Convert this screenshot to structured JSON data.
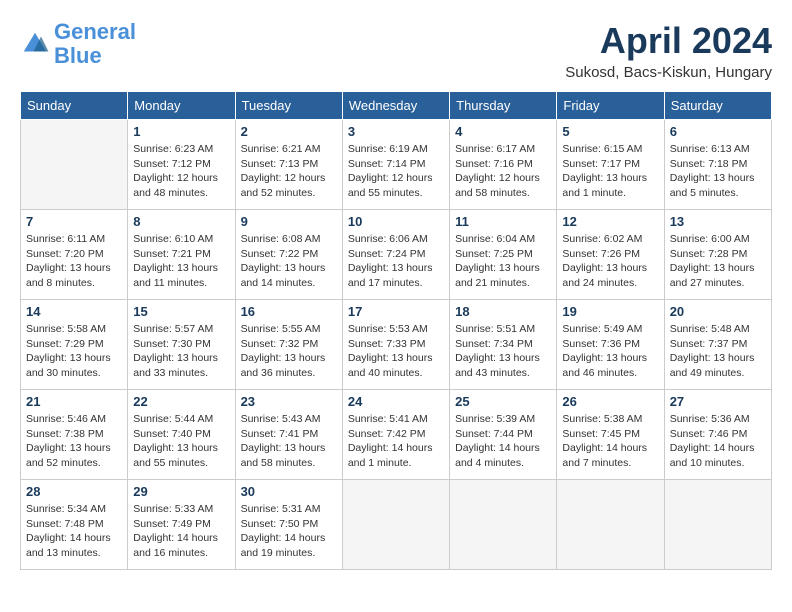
{
  "logo": {
    "text_general": "General",
    "text_blue": "Blue"
  },
  "title": "April 2024",
  "subtitle": "Sukosd, Bacs-Kiskun, Hungary",
  "days_of_week": [
    "Sunday",
    "Monday",
    "Tuesday",
    "Wednesday",
    "Thursday",
    "Friday",
    "Saturday"
  ],
  "weeks": [
    [
      {
        "day": "",
        "info": ""
      },
      {
        "day": "1",
        "info": "Sunrise: 6:23 AM\nSunset: 7:12 PM\nDaylight: 12 hours\nand 48 minutes."
      },
      {
        "day": "2",
        "info": "Sunrise: 6:21 AM\nSunset: 7:13 PM\nDaylight: 12 hours\nand 52 minutes."
      },
      {
        "day": "3",
        "info": "Sunrise: 6:19 AM\nSunset: 7:14 PM\nDaylight: 12 hours\nand 55 minutes."
      },
      {
        "day": "4",
        "info": "Sunrise: 6:17 AM\nSunset: 7:16 PM\nDaylight: 12 hours\nand 58 minutes."
      },
      {
        "day": "5",
        "info": "Sunrise: 6:15 AM\nSunset: 7:17 PM\nDaylight: 13 hours\nand 1 minute."
      },
      {
        "day": "6",
        "info": "Sunrise: 6:13 AM\nSunset: 7:18 PM\nDaylight: 13 hours\nand 5 minutes."
      }
    ],
    [
      {
        "day": "7",
        "info": "Sunrise: 6:11 AM\nSunset: 7:20 PM\nDaylight: 13 hours\nand 8 minutes."
      },
      {
        "day": "8",
        "info": "Sunrise: 6:10 AM\nSunset: 7:21 PM\nDaylight: 13 hours\nand 11 minutes."
      },
      {
        "day": "9",
        "info": "Sunrise: 6:08 AM\nSunset: 7:22 PM\nDaylight: 13 hours\nand 14 minutes."
      },
      {
        "day": "10",
        "info": "Sunrise: 6:06 AM\nSunset: 7:24 PM\nDaylight: 13 hours\nand 17 minutes."
      },
      {
        "day": "11",
        "info": "Sunrise: 6:04 AM\nSunset: 7:25 PM\nDaylight: 13 hours\nand 21 minutes."
      },
      {
        "day": "12",
        "info": "Sunrise: 6:02 AM\nSunset: 7:26 PM\nDaylight: 13 hours\nand 24 minutes."
      },
      {
        "day": "13",
        "info": "Sunrise: 6:00 AM\nSunset: 7:28 PM\nDaylight: 13 hours\nand 27 minutes."
      }
    ],
    [
      {
        "day": "14",
        "info": "Sunrise: 5:58 AM\nSunset: 7:29 PM\nDaylight: 13 hours\nand 30 minutes."
      },
      {
        "day": "15",
        "info": "Sunrise: 5:57 AM\nSunset: 7:30 PM\nDaylight: 13 hours\nand 33 minutes."
      },
      {
        "day": "16",
        "info": "Sunrise: 5:55 AM\nSunset: 7:32 PM\nDaylight: 13 hours\nand 36 minutes."
      },
      {
        "day": "17",
        "info": "Sunrise: 5:53 AM\nSunset: 7:33 PM\nDaylight: 13 hours\nand 40 minutes."
      },
      {
        "day": "18",
        "info": "Sunrise: 5:51 AM\nSunset: 7:34 PM\nDaylight: 13 hours\nand 43 minutes."
      },
      {
        "day": "19",
        "info": "Sunrise: 5:49 AM\nSunset: 7:36 PM\nDaylight: 13 hours\nand 46 minutes."
      },
      {
        "day": "20",
        "info": "Sunrise: 5:48 AM\nSunset: 7:37 PM\nDaylight: 13 hours\nand 49 minutes."
      }
    ],
    [
      {
        "day": "21",
        "info": "Sunrise: 5:46 AM\nSunset: 7:38 PM\nDaylight: 13 hours\nand 52 minutes."
      },
      {
        "day": "22",
        "info": "Sunrise: 5:44 AM\nSunset: 7:40 PM\nDaylight: 13 hours\nand 55 minutes."
      },
      {
        "day": "23",
        "info": "Sunrise: 5:43 AM\nSunset: 7:41 PM\nDaylight: 13 hours\nand 58 minutes."
      },
      {
        "day": "24",
        "info": "Sunrise: 5:41 AM\nSunset: 7:42 PM\nDaylight: 14 hours\nand 1 minute."
      },
      {
        "day": "25",
        "info": "Sunrise: 5:39 AM\nSunset: 7:44 PM\nDaylight: 14 hours\nand 4 minutes."
      },
      {
        "day": "26",
        "info": "Sunrise: 5:38 AM\nSunset: 7:45 PM\nDaylight: 14 hours\nand 7 minutes."
      },
      {
        "day": "27",
        "info": "Sunrise: 5:36 AM\nSunset: 7:46 PM\nDaylight: 14 hours\nand 10 minutes."
      }
    ],
    [
      {
        "day": "28",
        "info": "Sunrise: 5:34 AM\nSunset: 7:48 PM\nDaylight: 14 hours\nand 13 minutes."
      },
      {
        "day": "29",
        "info": "Sunrise: 5:33 AM\nSunset: 7:49 PM\nDaylight: 14 hours\nand 16 minutes."
      },
      {
        "day": "30",
        "info": "Sunrise: 5:31 AM\nSunset: 7:50 PM\nDaylight: 14 hours\nand 19 minutes."
      },
      {
        "day": "",
        "info": ""
      },
      {
        "day": "",
        "info": ""
      },
      {
        "day": "",
        "info": ""
      },
      {
        "day": "",
        "info": ""
      }
    ]
  ]
}
